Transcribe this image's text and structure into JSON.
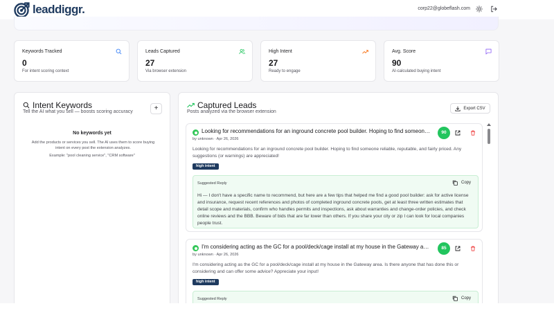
{
  "app": {
    "logo_text": "leaddiggr."
  },
  "header": {
    "user_email": "corp22@globeflash.com",
    "theme_icon": "sun-icon",
    "logout_icon": "logout-icon"
  },
  "colors": {
    "brand": "#1e3a5f",
    "score_green": "#22c55e",
    "reply_bg": "#f0fbf3",
    "danger": "#ef4444",
    "intent_orange": "#f97316",
    "leads_green": "#22c55e",
    "avg_purple": "#8b5cf6",
    "search_blue": "#3b82f6"
  },
  "stats": [
    {
      "title": "Keywords Tracked",
      "value": "0",
      "sub": "For intent scoring context",
      "icon": "search-icon"
    },
    {
      "title": "Leads Captured",
      "value": "27",
      "sub": "Via browser extension",
      "icon": "users-icon"
    },
    {
      "title": "High Intent",
      "value": "27",
      "sub": "Ready to engage",
      "icon": "trending-up-icon"
    },
    {
      "title": "Avg. Score",
      "value": "90",
      "sub": "AI-calculated buying intent",
      "icon": "message-icon"
    }
  ],
  "keywords_panel": {
    "title": "Intent Keywords",
    "subtitle": "Tell the AI what you sell — boosts scoring accuracy",
    "add_label": "+",
    "empty_title": "No keywords yet",
    "empty_desc": "Add the products or services you sell. The AI uses them to score buying intent on every post the extension analyzes.",
    "empty_example": "Example: \"pool cleaning service\", \"CRM software\""
  },
  "leads_panel": {
    "title": "Captured Leads",
    "subtitle": "Posts analyzed via the browser extension",
    "export_label": "Export CSV",
    "leads": [
      {
        "title": "Looking for recommendations for an inground concrete pool builder. Hoping to find someone reliable, reputable, and fairly priced.",
        "meta": "by unknown · Apr 26, 2026",
        "score": "90",
        "body": "Looking for recommendations for an inground concrete pool builder. Hoping to find someone reliable, reputable, and fairly priced. Any suggestions (or warnings) are appreciated!",
        "badge": "high intent",
        "reply_label": "Suggested Reply",
        "copy_label": "Copy",
        "reply": "Hi — I don't have a specific name to recommend, but here are a few tips that helped me find a good pool builder: ask for active license and insurance, request recent references and photos of completed inground concrete pools, get at least three written estimates that detail scope and materials, confirm who handles permits and inspections, ask about warranties and change-order policies, and check online reviews and the BBB. Beware of bids that are far lower than others. If you share your city or zip I can look for local companies people trust."
      },
      {
        "title": "I'm considering acting as the GC for a pool/deck/cage install at my house in the Gateway area. Is there anyone that has done this?",
        "meta": "by unknown · Apr 26, 2026",
        "score": "85",
        "body": "I'm considering acting as the GC for a pool/deck/cage install at my house in the Gateway area. Is there anyone that has done this or considering and can offer some advice? Appreciate your input!",
        "badge": "high intent",
        "reply_label": "Suggested Reply",
        "copy_label": "Copy",
        "reply": ""
      }
    ]
  }
}
